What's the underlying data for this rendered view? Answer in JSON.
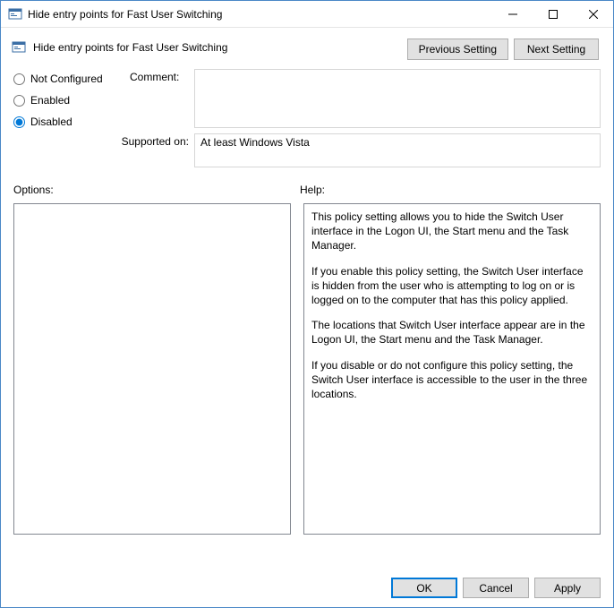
{
  "window": {
    "title": "Hide entry points for Fast User Switching"
  },
  "header": {
    "title": "Hide entry points for Fast User Switching"
  },
  "nav": {
    "previous": "Previous Setting",
    "next": "Next Setting"
  },
  "state": {
    "not_configured": "Not Configured",
    "enabled": "Enabled",
    "disabled": "Disabled",
    "selected": "disabled"
  },
  "fields": {
    "comment_label": "Comment:",
    "comment_value": "",
    "supported_label": "Supported on:",
    "supported_value": "At least Windows Vista"
  },
  "panels": {
    "options_label": "Options:",
    "help_label": "Help:"
  },
  "help": {
    "p1": "This policy setting allows you to hide the Switch User interface in the Logon UI, the Start menu and the Task Manager.",
    "p2": "If you enable this policy setting, the Switch User interface is hidden from the user who is attempting to log on or is logged on to the computer that has this policy applied.",
    "p3": "The locations that Switch User interface appear are in the Logon UI, the Start menu and the Task Manager.",
    "p4": "If you disable or do not configure this policy setting, the Switch User interface is accessible to the user in the three locations."
  },
  "footer": {
    "ok": "OK",
    "cancel": "Cancel",
    "apply": "Apply"
  }
}
